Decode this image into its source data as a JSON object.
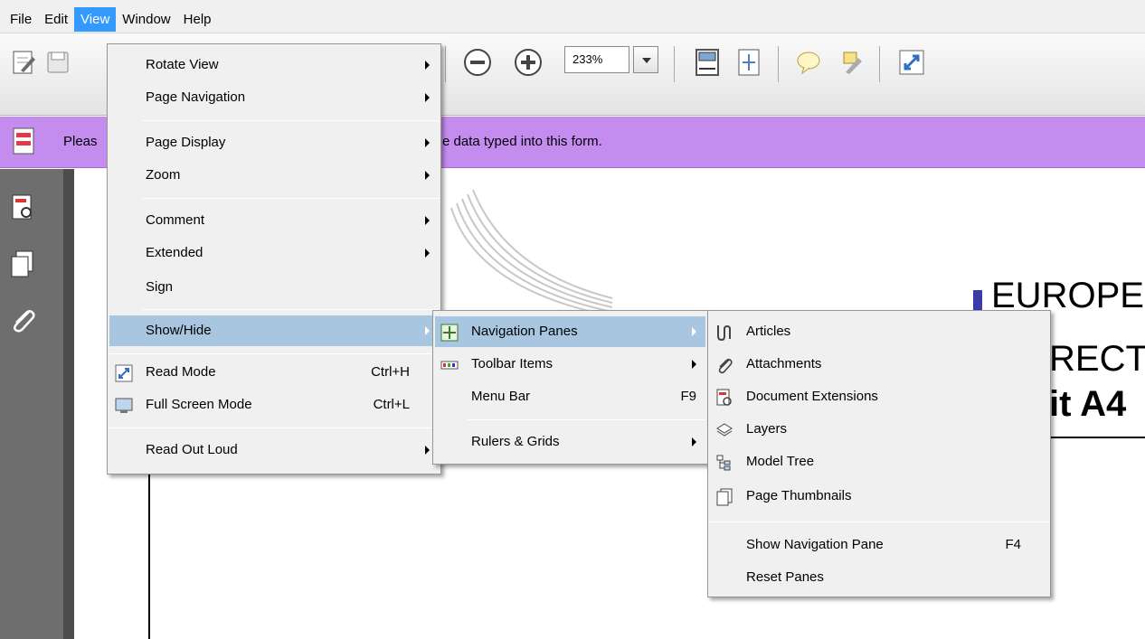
{
  "menubar": {
    "items": [
      "File",
      "Edit",
      "View",
      "Window",
      "Help"
    ],
    "active": "View"
  },
  "toolbar": {
    "zoom_value": "233%",
    "icons": [
      "edit-icon",
      "save-icon",
      "zoom-out-icon",
      "zoom-in-icon",
      "zoom-dropdown-icon",
      "fit-page-icon",
      "fit-width-icon",
      "comment-icon",
      "highlight-icon",
      "read-mode-icon"
    ]
  },
  "message_bar": {
    "text_left": "Pleas",
    "text_right": "e data typed into this form."
  },
  "document": {
    "line1": "EUROPE",
    "line2": "RECTC",
    "line3": "it A4"
  },
  "view_menu": {
    "rotate_view": "Rotate View",
    "page_navigation": "Page Navigation",
    "page_display": "Page Display",
    "zoom": "Zoom",
    "comment": "Comment",
    "extended": "Extended",
    "sign": "Sign",
    "show_hide": "Show/Hide",
    "read_mode": "Read Mode",
    "read_mode_shortcut": "Ctrl+H",
    "full_screen_mode": "Full Screen Mode",
    "full_screen_shortcut": "Ctrl+L",
    "read_out_loud": "Read Out Loud"
  },
  "show_hide_menu": {
    "navigation_panes": "Navigation Panes",
    "toolbar_items": "Toolbar Items",
    "menu_bar": "Menu Bar",
    "menu_bar_shortcut": "F9",
    "rulers_grids": "Rulers & Grids"
  },
  "nav_panes_menu": {
    "articles": "Articles",
    "attachments": "Attachments",
    "document_extensions": "Document Extensions",
    "layers": "Layers",
    "model_tree": "Model Tree",
    "page_thumbnails": "Page Thumbnails",
    "show_navigation_pane": "Show Navigation Pane",
    "show_navigation_pane_shortcut": "F4",
    "reset_panes": "Reset Panes"
  }
}
